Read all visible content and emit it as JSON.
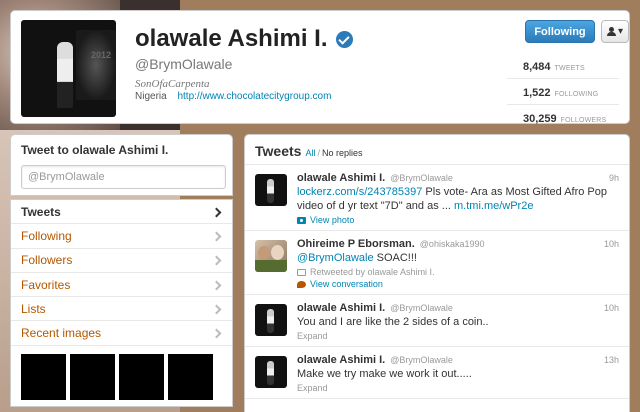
{
  "profile": {
    "name": "olawale Ashimi I.",
    "handle": "@BrymOlawale",
    "tagline": "SonOfaCarpenta",
    "location": "Nigeria",
    "url": "http://www.chocolatecitygroup.com",
    "avatar_text": "2012",
    "follow_label": "Following",
    "user_menu_icon": "user-dropdown-icon",
    "stats": [
      {
        "num": "8,484",
        "label": "TWEETS"
      },
      {
        "num": "1,522",
        "label": "FOLLOWING"
      },
      {
        "num": "30,259",
        "label": "FOLLOWERS"
      }
    ]
  },
  "tweet_to": {
    "title": "Tweet to olawale Ashimi I.",
    "placeholder": "@BrymOlawale"
  },
  "nav": [
    {
      "label": "Tweets"
    },
    {
      "label": "Following"
    },
    {
      "label": "Followers"
    },
    {
      "label": "Favorites"
    },
    {
      "label": "Lists"
    },
    {
      "label": "Recent images"
    }
  ],
  "tweets_panel": {
    "title": "Tweets",
    "all": "All",
    "sep": "/",
    "no_replies": "No replies"
  },
  "tweets": [
    {
      "name": "olawale Ashimi I.",
      "screen_name": "@BrymOlawale",
      "time": "9h",
      "link1": "lockerz.com/s/243785397",
      "text_mid": " Pls vote- Ara as Most Gifted Afro Pop video of d yr text \"7D\" and as ... ",
      "link2": "m.tmi.me/wPr2e",
      "meta": "View photo"
    },
    {
      "name": "Ohireime P Eborsman.",
      "screen_name": "@ohiskaka1990",
      "time": "10h",
      "mention": "@BrymOlawale",
      "text": " SOAC!!!",
      "retweeted": "Retweeted by olawale Ashimi I.",
      "meta": "View conversation"
    },
    {
      "name": "olawale Ashimi I.",
      "screen_name": "@BrymOlawale",
      "time": "10h",
      "text": "You and I are like the 2 sides of a coin..",
      "meta": "Expand"
    },
    {
      "name": "olawale Ashimi I.",
      "screen_name": "@BrymOlawale",
      "time": "13h",
      "text": "Make we try make we work it out.....",
      "meta": "Expand"
    }
  ]
}
